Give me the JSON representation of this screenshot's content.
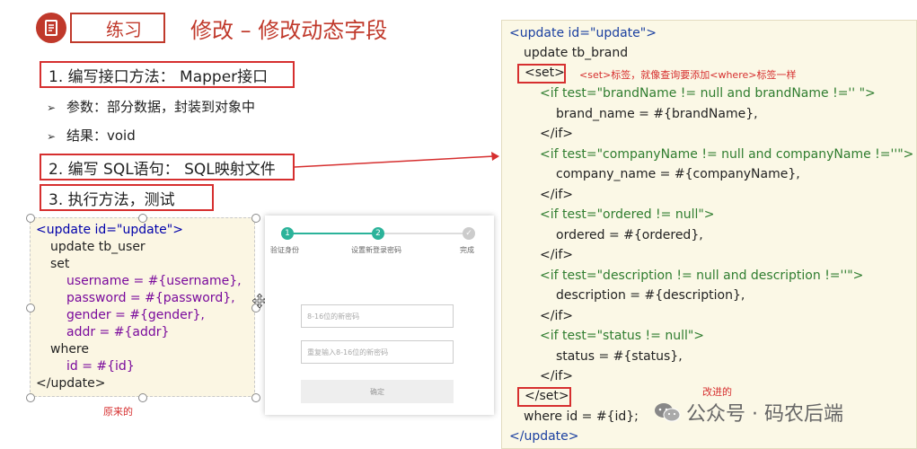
{
  "header": {
    "tag": "练习",
    "title": "修改 – 修改动态字段"
  },
  "steps": [
    {
      "label": "1.  编写接口方法：  Mapper接口"
    },
    {
      "label": "2.  编写 SQL语句：  SQL映射文件"
    },
    {
      "label": "3.  执行方法，测试"
    }
  ],
  "bullets": [
    {
      "label": "参数：部分数据，封装到对象中"
    },
    {
      "label": "结果：void"
    }
  ],
  "left_code": {
    "lines": [
      "<update id=\"update\">",
      "update tb_user",
      "set",
      "username = #{username},",
      "password = #{password},",
      "gender = #{gender},",
      "addr = #{addr}",
      "where",
      "id = #{id}",
      "</update>"
    ],
    "label": "原来的"
  },
  "mockup": {
    "step1_num": "1",
    "step2_num": "2",
    "step3_num": "✓",
    "step1_label": "验证身份",
    "step2_label": "设置新登录密码",
    "step3_label": "完成",
    "input1_placeholder": "8-16位的新密码",
    "input2_placeholder": "重复输入8-16位的新密码",
    "confirm_label": "确定"
  },
  "right_code": {
    "l1": "<update id=\"update\">",
    "l2": "update tb_brand",
    "l3": "<set>",
    "set_note": "<set>标签，就像查询要添加<where>标签一样",
    "l4": "<if test=\"brandName != null and brandName !='' \">",
    "l5": "brand_name = #{brandName},",
    "l6": "</if>",
    "l7": "<if test=\"companyName != null and companyName !=''\">",
    "l8": "company_name = #{companyName},",
    "l9": "</if>",
    "l10": "<if test=\"ordered != null\">",
    "l11": "ordered = #{ordered},",
    "l12": "</if>",
    "l13": "<if test=\"description != null and description !=''\">",
    "l14": "description = #{description},",
    "l15": "</if>",
    "l16": "<if test=\"status != null\">",
    "l17": "status = #{status},",
    "l18": "</if>",
    "l19": "</set>",
    "improved_note": "改进的",
    "l20": "where id = #{id};",
    "l21": "</update>"
  },
  "watermark": {
    "text": "公众号 · 码农后端"
  },
  "colors": {
    "accent_red": "#d62f2f",
    "mock_teal": "#2bb39a",
    "code_green": "#2f7d2f"
  }
}
